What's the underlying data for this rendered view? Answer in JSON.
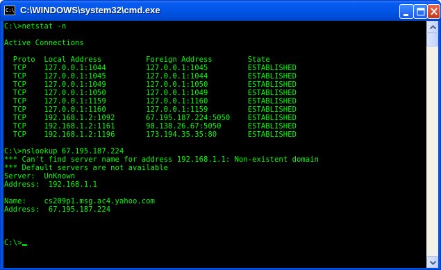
{
  "window": {
    "title": "C:\\WINDOWS\\system32\\cmd.exe",
    "icon_label": "C:\\",
    "icons": {
      "app": "console-app-icon",
      "minimize": "minimize-icon",
      "maximize": "maximize-icon",
      "close": "close-icon"
    }
  },
  "console": {
    "text_color": "#00ff00",
    "background": "#000000",
    "lines": [
      "C:\\>netstat -n",
      "",
      "Active Connections",
      "",
      "  Proto  Local Address          Foreign Address        State",
      "  TCP    127.0.0.1:1044         127.0.0.1:1045         ESTABLISHED",
      "  TCP    127.0.0.1:1045         127.0.0.1:1044         ESTABLISHED",
      "  TCP    127.0.0.1:1049         127.0.0.1:1050         ESTABLISHED",
      "  TCP    127.0.0.1:1050         127.0.0.1:1049         ESTABLISHED",
      "  TCP    127.0.0.1:1159         127.0.0.1:1160         ESTABLISHED",
      "  TCP    127.0.0.1:1160         127.0.0.1:1159         ESTABLISHED",
      "  TCP    192.168.1.2:1092       67.195.187.224:5050    ESTABLISHED",
      "  TCP    192.168.1.2:1161       98.138.26.67:5050      ESTABLISHED",
      "  TCP    192.168.1.2:1196       173.194.35.35:80       ESTABLISHED",
      "",
      "C:\\>nslookup 67.195.187.224",
      "*** Can't find server name for address 192.168.1.1: Non-existent domain",
      "*** Default servers are not available",
      "Server:  UnKnown",
      "Address:  192.168.1.1",
      "",
      "Name:    cs209p1.msg.ac4.yahoo.com",
      "Address:  67.195.187.224",
      "",
      "",
      ""
    ],
    "prompt": "C:\\>"
  },
  "scrollbar": {
    "up_icon": "scroll-up-arrow-icon",
    "down_icon": "scroll-down-arrow-icon"
  }
}
